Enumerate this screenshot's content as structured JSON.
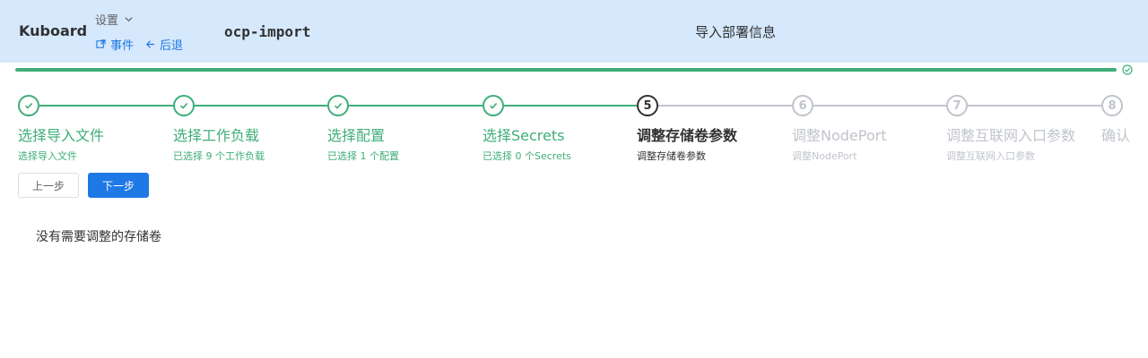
{
  "header": {
    "brand": "Kuboard",
    "settings_label": "设置",
    "events_label": "事件",
    "back_label": "后退",
    "app_name": "ocp-import",
    "page_title": "导入部署信息"
  },
  "progress": {
    "percent": 100
  },
  "steps": [
    {
      "number": "1",
      "title": "选择导入文件",
      "description": "选择导入文件",
      "status": "done"
    },
    {
      "number": "2",
      "title": "选择工作负载",
      "description": "已选择 9 个工作负载",
      "status": "done"
    },
    {
      "number": "3",
      "title": "选择配置",
      "description": "已选择 1 个配置",
      "status": "done"
    },
    {
      "number": "4",
      "title": "选择Secrets",
      "description": "已选择 0 个Secrets",
      "status": "done"
    },
    {
      "number": "5",
      "title": "调整存储卷参数",
      "description": "调整存储卷参数",
      "status": "active"
    },
    {
      "number": "6",
      "title": "调整NodePort",
      "description": "调整NodePort",
      "status": "wait"
    },
    {
      "number": "7",
      "title": "调整互联网入口参数",
      "description": "调整互联网入口参数",
      "status": "wait"
    },
    {
      "number": "8",
      "title": "确认",
      "description": "",
      "status": "wait"
    }
  ],
  "buttons": {
    "prev_label": "上一步",
    "next_label": "下一步"
  },
  "content": {
    "message": "没有需要调整的存储卷"
  },
  "colors": {
    "success": "#3fae78",
    "primary": "#1e78e6",
    "header_bg": "#d6e8fb",
    "wait": "#c0c4cc"
  },
  "icons": {
    "settings_chevron": "chevron-down-icon",
    "events": "external-link-icon",
    "back": "arrow-left-icon",
    "step_done": "check-icon",
    "progress_done": "check-circle-icon"
  }
}
